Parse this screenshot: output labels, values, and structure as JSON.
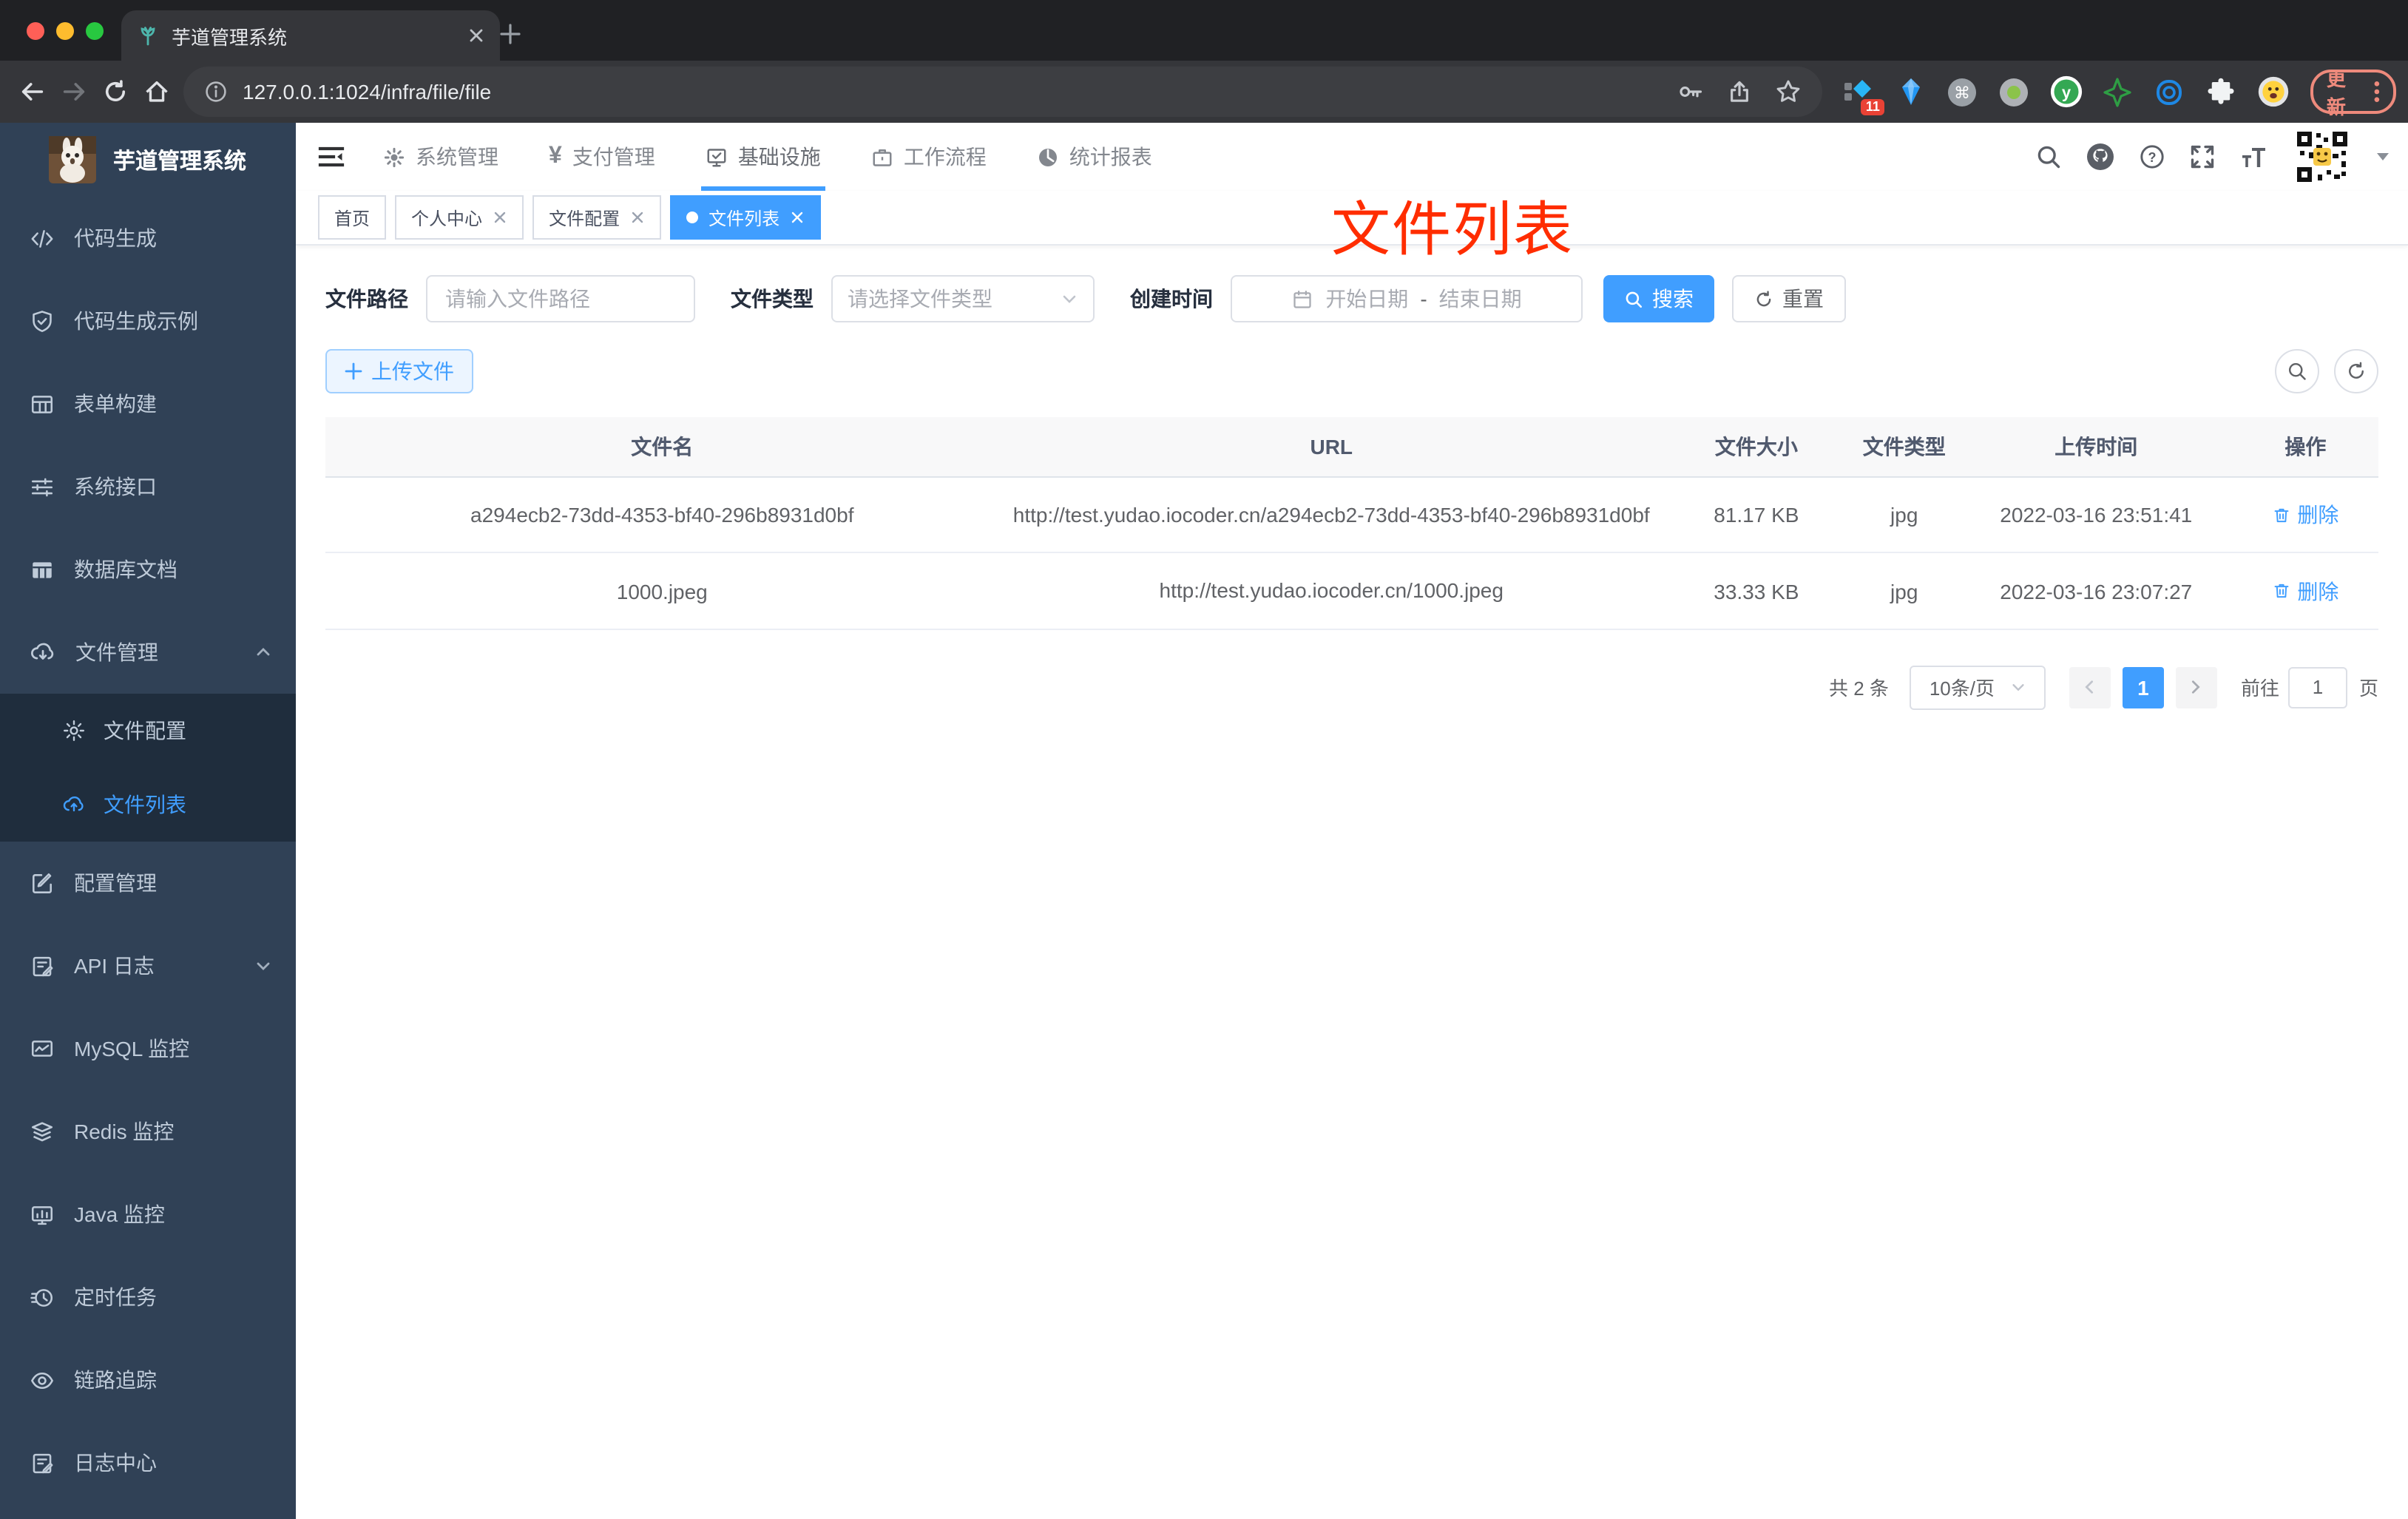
{
  "browser": {
    "tab_title": "芋道管理系统",
    "url": "127.0.0.1:1024/infra/file/file",
    "extension_badge": "11",
    "update_label": "更新"
  },
  "sidebar": {
    "title": "芋道管理系统",
    "items": [
      {
        "label": "代码生成"
      },
      {
        "label": "代码生成示例"
      },
      {
        "label": "表单构建"
      },
      {
        "label": "系统接口"
      },
      {
        "label": "数据库文档"
      },
      {
        "label": "文件管理"
      },
      {
        "label": "配置管理"
      },
      {
        "label": "API 日志"
      },
      {
        "label": "MySQL 监控"
      },
      {
        "label": "Redis 监控"
      },
      {
        "label": "Java 监控"
      },
      {
        "label": "定时任务"
      },
      {
        "label": "链路追踪"
      },
      {
        "label": "日志中心"
      }
    ],
    "submenu": [
      {
        "label": "文件配置"
      },
      {
        "label": "文件列表"
      }
    ]
  },
  "topnav": {
    "items": [
      {
        "label": "系统管理"
      },
      {
        "label": "支付管理"
      },
      {
        "label": "基础设施"
      },
      {
        "label": "工作流程"
      },
      {
        "label": "统计报表"
      }
    ]
  },
  "tags": [
    {
      "label": "首页"
    },
    {
      "label": "个人中心"
    },
    {
      "label": "文件配置"
    },
    {
      "label": "文件列表"
    }
  ],
  "annotation": "文件列表",
  "filters": {
    "path_label": "文件路径",
    "path_placeholder": "请输入文件路径",
    "type_label": "文件类型",
    "type_placeholder": "请选择文件类型",
    "time_label": "创建时间",
    "date_start": "开始日期",
    "date_separator": "-",
    "date_end": "结束日期",
    "search_label": "搜索",
    "reset_label": "重置"
  },
  "toolbar": {
    "upload_label": "上传文件"
  },
  "table": {
    "headers": [
      "文件名",
      "URL",
      "文件大小",
      "文件类型",
      "上传时间",
      "操作"
    ],
    "rows": [
      {
        "name": "a294ecb2-73dd-4353-bf40-296b8931d0bf",
        "url": "http://test.yudao.iocoder.cn/a294ecb2-73dd-4353-bf40-296b8931d0bf",
        "size": "81.17 KB",
        "type": "jpg",
        "time": "2022-03-16 23:51:41",
        "action": "删除"
      },
      {
        "name": "1000.jpeg",
        "url": "http://test.yudao.iocoder.cn/1000.jpeg",
        "size": "33.33 KB",
        "type": "jpg",
        "time": "2022-03-16 23:07:27",
        "action": "删除"
      }
    ]
  },
  "pagination": {
    "total": "共 2 条",
    "page_size": "10条/页",
    "current_page": "1",
    "goto_label": "前往",
    "goto_value": "1",
    "page_unit": "页"
  },
  "colors": {
    "primary": "#409eff",
    "annotation_red": "#ff2d00",
    "sidebar_bg": "#304156",
    "submenu_bg": "#1f2d3d"
  }
}
